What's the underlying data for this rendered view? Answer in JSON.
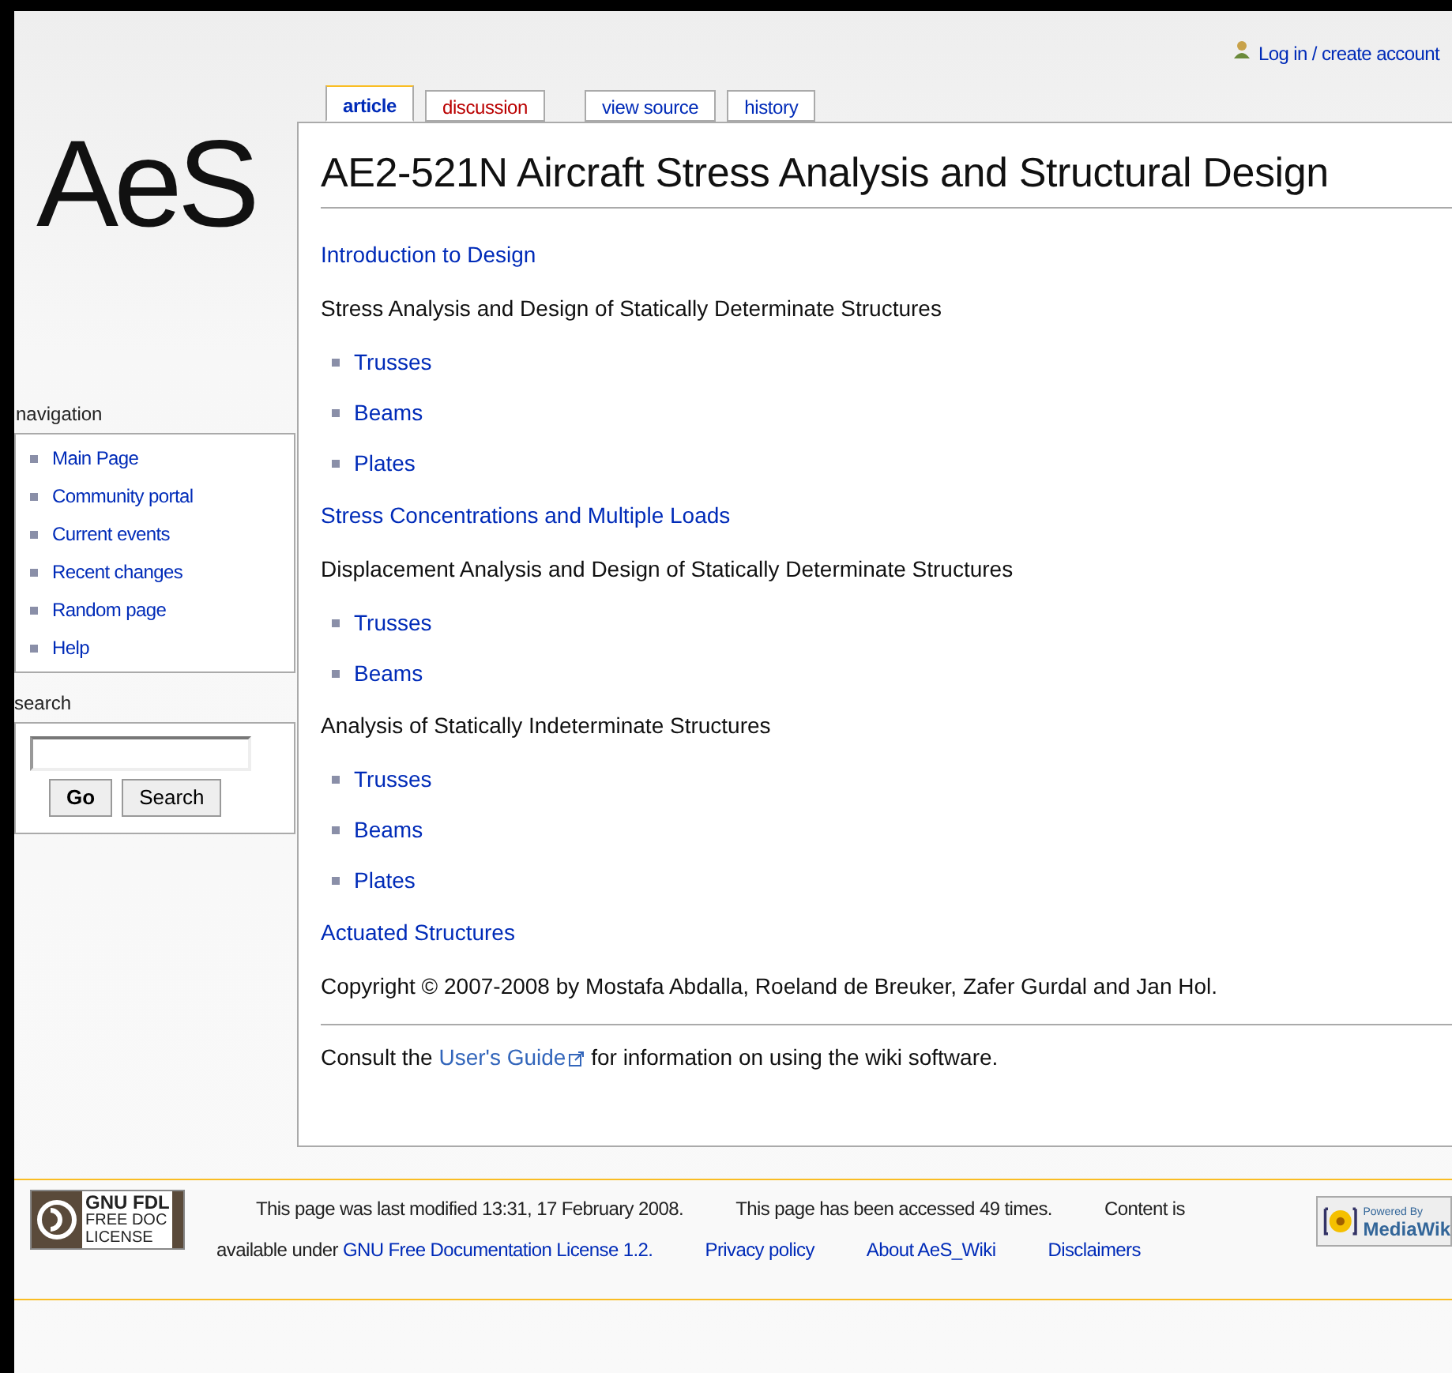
{
  "personal": {
    "login": "Log in / create account"
  },
  "logo": {
    "text": "AeS"
  },
  "tabs": [
    {
      "label": "article",
      "selected": true,
      "exists": true
    },
    {
      "label": "discussion",
      "selected": false,
      "exists": false
    },
    {
      "label": "view source",
      "selected": false,
      "exists": true
    },
    {
      "label": "history",
      "selected": false,
      "exists": true
    }
  ],
  "sidebar": {
    "navigation": {
      "title": "navigation",
      "items": [
        "Main Page",
        "Community portal",
        "Current events",
        "Recent changes",
        "Random page",
        "Help"
      ]
    },
    "search": {
      "title": "search",
      "buttons": [
        "Go",
        "Search"
      ]
    }
  },
  "content": {
    "title": "AE2-521N Aircraft Stress Analysis and Structural Design",
    "lines": [
      {
        "kind": "link",
        "text": "Introduction to Design"
      },
      {
        "kind": "text",
        "text": "Stress Analysis and Design of Statically Determinate Structures"
      },
      {
        "kind": "bullet",
        "text": "Trusses"
      },
      {
        "kind": "bullet",
        "text": "Beams"
      },
      {
        "kind": "bullet",
        "text": "Plates"
      },
      {
        "kind": "link",
        "text": "Stress Concentrations and Multiple Loads"
      },
      {
        "kind": "text",
        "text": "Displacement Analysis and Design of Statically Determinate Structures"
      },
      {
        "kind": "bullet",
        "text": "Trusses"
      },
      {
        "kind": "bullet",
        "text": "Beams"
      },
      {
        "kind": "text",
        "text": "Analysis of Statically Indeterminate Structures"
      },
      {
        "kind": "bullet",
        "text": "Trusses"
      },
      {
        "kind": "bullet",
        "text": "Beams"
      },
      {
        "kind": "bullet",
        "text": "Plates"
      },
      {
        "kind": "link",
        "text": "Actuated Structures"
      },
      {
        "kind": "text",
        "text": "Copyright © 2007-2008 by Mostafa Abdalla, Roeland de Breuker, Zafer Gurdal and Jan Hol."
      }
    ],
    "note": {
      "before": "Consult the",
      "link": "User's Guide",
      "after": "for information on using the wiki software."
    }
  },
  "footer": {
    "license_badge": [
      "GNU FDL",
      "FREE DOC",
      "LICENSE"
    ],
    "modified": "This page was last modified 13:31, 17 February 2008.",
    "accessed": "This page has been accessed 49 times.",
    "content_is": "Content is",
    "license": {
      "before": "available under",
      "link": "GNU Free Documentation License 1.2."
    },
    "links": [
      "Privacy policy",
      "About AeS_Wiki",
      "Disclaimers"
    ],
    "powered": [
      "Powered By",
      "MediaWik"
    ]
  }
}
